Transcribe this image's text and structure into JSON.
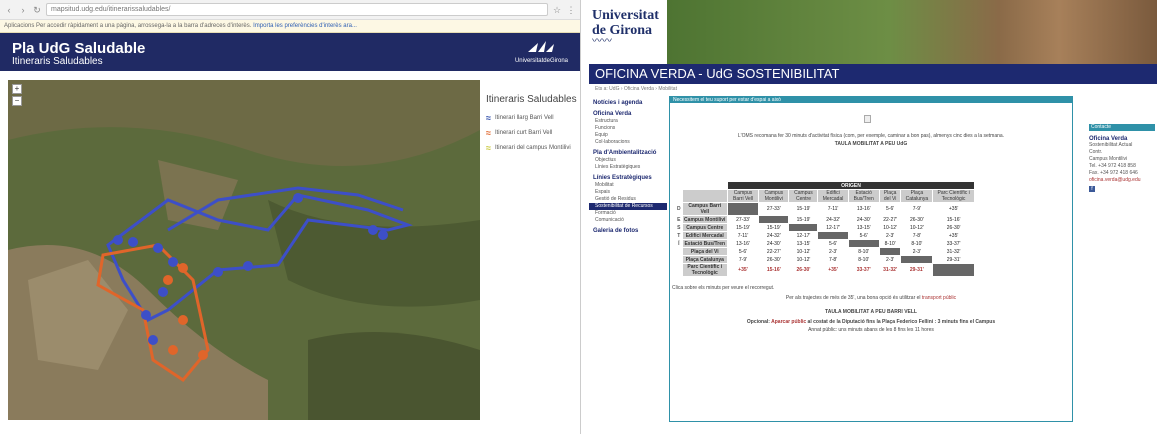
{
  "left_app": {
    "browser": {
      "url": "mapsitud.udg.edu/itinerarissaludables/",
      "infobar_text": "Aplicacions   Per accedir ràpidament a una pàgina, arrossega-la a la barra d'adreces d'interès.",
      "infobar_link": "Importa les preferències d'interès ara..."
    },
    "header": {
      "title": "Pla UdG Saludable",
      "subtitle": "Itineraris Saludables",
      "logo_text": "UniversitatdeGirona"
    },
    "zoom": {
      "in": "+",
      "out": "−"
    },
    "legend": {
      "title": "Itineraris Saludables",
      "items": [
        {
          "label": "Itinerari llarg Barri Vell",
          "color": "#2b4aa8"
        },
        {
          "label": "Itinerari curt Barri Vell",
          "color": "#e0652a"
        },
        {
          "label": "Itinerari del campus Montilivi",
          "color": "#c8c83a"
        }
      ]
    }
  },
  "right_site": {
    "logo": {
      "line1": "Universitat",
      "line2": "de Girona"
    },
    "title": "OFICINA VERDA - UdG SOSTENIBILITAT",
    "breadcrumb": "Ets a: UdG › Oficina Verda › Mobilitat",
    "nav": [
      {
        "type": "head",
        "label": "Notícies i agenda"
      },
      {
        "type": "head",
        "label": "Oficina Verda"
      },
      {
        "type": "sub",
        "label": "Estructura"
      },
      {
        "type": "sub",
        "label": "Funcions"
      },
      {
        "type": "sub",
        "label": "Equip"
      },
      {
        "type": "sub",
        "label": "Col·laboracions"
      },
      {
        "type": "head",
        "label": "Pla d'Ambientalització"
      },
      {
        "type": "sub",
        "label": "Objectius"
      },
      {
        "type": "sub",
        "label": "Línies Estratègiques"
      },
      {
        "type": "head",
        "label": "Línies Estratègiques"
      },
      {
        "type": "sub",
        "label": "Mobilitat"
      },
      {
        "type": "sub",
        "label": "Espais"
      },
      {
        "type": "sub",
        "label": "Gestió de Residus"
      },
      {
        "type": "sub",
        "label": "Sostenibilitat de Recursos",
        "active": true
      },
      {
        "type": "sub",
        "label": "Formació"
      },
      {
        "type": "sub",
        "label": "Comunicació"
      },
      {
        "type": "head",
        "label": "Galeria de fotos"
      }
    ],
    "content": {
      "bar_label": "Necessitem el teu suport per estar d'espai a això",
      "intro": "L'OMS recomana fer 30 minuts d'activitat física (com, per exemple, caminar a bon pas), almenys cinc dies a la setmana.",
      "table_title": "TAULA MOBILITAT A PEU UdG",
      "origin_label": "ORIGEN",
      "side_label": "DESTÍ",
      "columns": [
        "Campus Barri Vell",
        "Campus Montilivi",
        "Campus Centre",
        "Edifici Mercadal",
        "Estació Bus/Tren",
        "Plaça del Vi",
        "Plaça Catalunya",
        "Parc Científic i Tecnològic"
      ],
      "rows": [
        {
          "name": "Campus Barri Vell",
          "cells": [
            "",
            "27-33'",
            "15-19'",
            "7-11'",
            "13-16'",
            "5-6'",
            "7-9'",
            "+35'"
          ]
        },
        {
          "name": "Campus Montilivi",
          "cells": [
            "27-33'",
            "",
            "15-19'",
            "24-32'",
            "24-30'",
            "22-27'",
            "26-30'",
            "15-16'"
          ]
        },
        {
          "name": "Campus Centre",
          "cells": [
            "15-19'",
            "15-19'",
            "",
            "12-17'",
            "13-15'",
            "10-12'",
            "10-12'",
            "26-30'"
          ]
        },
        {
          "name": "Edifici Mercadal",
          "cells": [
            "7-11'",
            "24-32'",
            "12-17'",
            "",
            "5-6'",
            "2-3'",
            "7-8'",
            "+35'"
          ]
        },
        {
          "name": "Estació Bus/Tren",
          "cells": [
            "13-16'",
            "24-30'",
            "13-15'",
            "5-6'",
            "",
            "8-10'",
            "8-10'",
            "33-37'"
          ]
        },
        {
          "name": "Plaça del Vi",
          "cells": [
            "5-6'",
            "22-27'",
            "10-12'",
            "2-3'",
            "8-10'",
            "",
            "2-3'",
            "31-32'"
          ]
        },
        {
          "name": "Plaça Catalunya",
          "cells": [
            "7-9'",
            "26-30'",
            "10-12'",
            "7-8'",
            "8-10'",
            "2-3'",
            "",
            "29-31'"
          ]
        },
        {
          "name": "Parc Científic i Tecnològic",
          "cells": [
            "+35'",
            "15-16'",
            "26-30'",
            "+35'",
            "33-37'",
            "31-32'",
            "29-31'",
            ""
          ]
        }
      ],
      "note1": "Clica sobre els minuts per veure el recorregut.",
      "note2_prefix": "Per als trajectes de més de 35', una bona opció és utilitzar el ",
      "note2_link": "transport públic",
      "table2_title": "TAULA MOBILITAT A PEU BARRI VELL",
      "optional_prefix": "Opcional: ",
      "optional_link": "Aparcar públic",
      "optional_text": " al costat de la Diputació fins la Plaça Federico Fellini : 3 minuts fins el Campus",
      "optional_sub": "Annat públic: uns minuts abans de les 8 fins les 11 hores"
    },
    "contact": {
      "bar_label": "Contacte",
      "title": "Oficina Verda",
      "lines": [
        "Sostenibilitat Actual",
        "Contr.",
        "Campus Montilivi",
        "Tel. +34 972 418 858",
        "Fax. +34 972 418 646"
      ],
      "email": "oficina.verda@udg.edu",
      "fb": "f"
    }
  }
}
